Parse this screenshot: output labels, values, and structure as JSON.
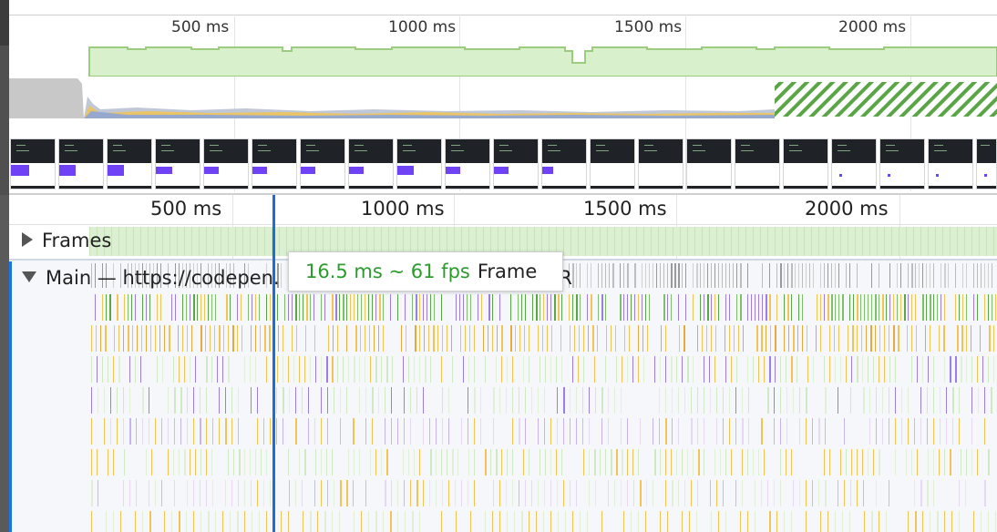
{
  "overview": {
    "ruler": [
      "500 ms",
      "1000 ms",
      "1500 ms",
      "2000 ms"
    ]
  },
  "timeline": {
    "ruler": [
      "500 ms",
      "1000 ms",
      "1500 ms",
      "2000 ms"
    ],
    "frames_label": "Frames",
    "main_label_prefix": "Main — https://codepen.",
    "main_label_suffix": "oKR"
  },
  "tooltip": {
    "fps_text": "16.5 ms ~ 61 fps",
    "kind": "Frame"
  },
  "colors": {
    "fps_green": "#9ccd7e",
    "fps_fill": "#d9f0cc",
    "cursor": "#1a6fd6",
    "scripting": "#f1c453",
    "rendering": "#9b7fe6",
    "painting": "#7fbf6a",
    "idle_hatch": "#5aa546"
  }
}
